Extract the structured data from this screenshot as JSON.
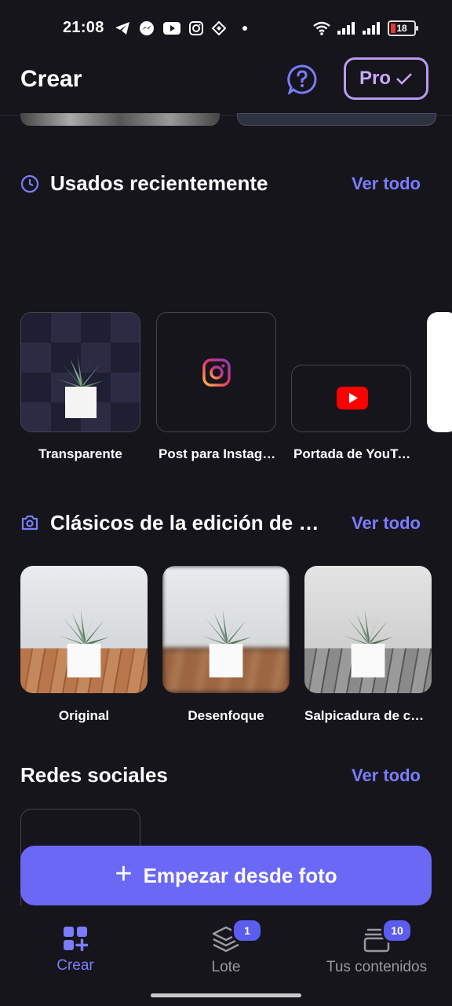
{
  "status_bar": {
    "time": "21:08",
    "battery_level": "18",
    "icons": [
      "telegram-icon",
      "messenger-icon",
      "youtube-icon",
      "instagram-icon",
      "binance-icon",
      "dot-icon",
      "wifi-icon",
      "signal-icon",
      "signal-icon",
      "battery-icon"
    ]
  },
  "header": {
    "title": "Crear",
    "pro_label": "Pro"
  },
  "recent": {
    "title": "Usados recientemente",
    "see_all": "Ver todo",
    "items": [
      {
        "label": "Transparente",
        "icon": "plant-icon"
      },
      {
        "label": "Post para Instagram",
        "icon": "instagram-icon"
      },
      {
        "label": "Portada de YouTube",
        "icon": "youtube-icon"
      }
    ]
  },
  "classics": {
    "title": "Clásicos de la edición de fotos",
    "see_all": "Ver todo",
    "items": [
      {
        "label": "Original"
      },
      {
        "label": "Desenfoque"
      },
      {
        "label": "Salpicadura de color"
      }
    ]
  },
  "social": {
    "title": "Redes sociales",
    "see_all": "Ver todo"
  },
  "cta": {
    "label": "Empezar desde foto"
  },
  "bottom_nav": [
    {
      "label": "Crear",
      "icon": "create-grid-icon",
      "active": true
    },
    {
      "label": "Lote",
      "icon": "layers-icon",
      "badge": "1"
    },
    {
      "label": "Tus contenidos",
      "icon": "folder-stack-icon",
      "badge": "10"
    }
  ],
  "colors": {
    "background": "#16151b",
    "accent": "#6b68f6",
    "link": "#7b7cff",
    "pro_border": "#b79bf3"
  }
}
